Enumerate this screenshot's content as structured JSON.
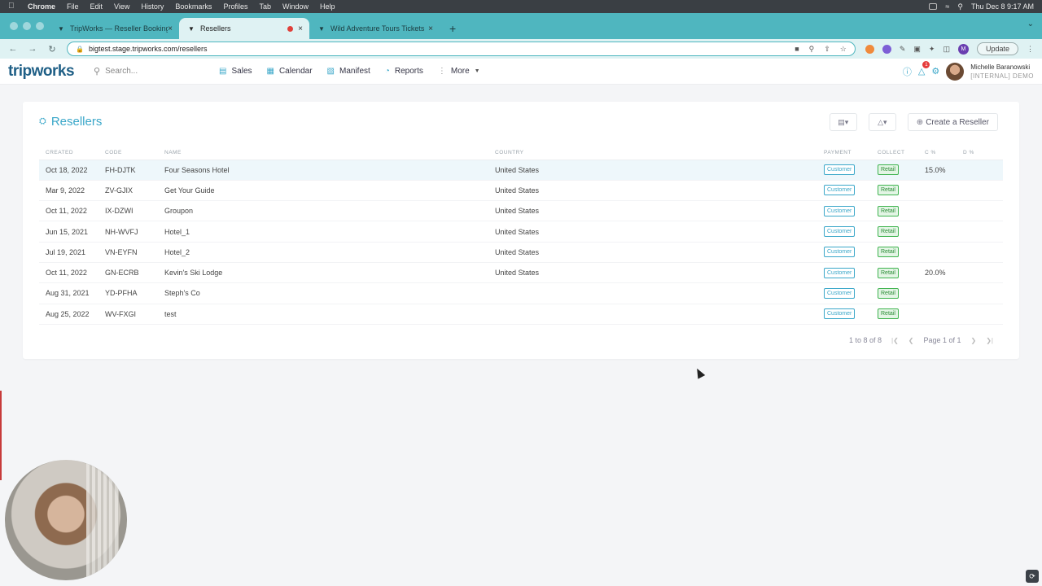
{
  "menubar": {
    "items": [
      "Chrome",
      "File",
      "Edit",
      "View",
      "History",
      "Bookmarks",
      "Profiles",
      "Tab",
      "Window",
      "Help"
    ],
    "clock": "Thu Dec 8  9:17 AM"
  },
  "browser": {
    "tabs": [
      {
        "title": "TripWorks — Reseller Booking",
        "icon": "tripworks-favicon"
      },
      {
        "title": "Resellers",
        "icon": "tripworks-favicon"
      },
      {
        "title": "Wild Adventure Tours Tickets",
        "icon": "tripworks-favicon"
      }
    ],
    "url": "bigtest.stage.tripworks.com/resellers",
    "update_label": "Update",
    "profile_initial": "M"
  },
  "app": {
    "logo": "tripworks",
    "search_placeholder": "Search...",
    "nav": [
      {
        "label": "Sales",
        "icon": "sales-icon"
      },
      {
        "label": "Calendar",
        "icon": "calendar-icon"
      },
      {
        "label": "Manifest",
        "icon": "clipboard-icon"
      },
      {
        "label": "Reports",
        "icon": "reports-icon"
      },
      {
        "label": "More",
        "icon": "more-icon"
      }
    ],
    "notification_count": "1",
    "user_name": "Michelle Baranowski",
    "user_org": "[INTERNAL] DEMO"
  },
  "page": {
    "title": "Resellers",
    "create_label": "Create a Reseller",
    "columns": [
      "CREATED",
      "CODE",
      "NAME",
      "COUNTRY",
      "PAYMENT",
      "COLLECT",
      "C %",
      "D %"
    ],
    "rows": [
      {
        "created": "Oct 18, 2022",
        "code": "FH-DJTK",
        "name": "Four Seasons Hotel",
        "country": "United States",
        "payment": "Customer",
        "collect": "Retail",
        "c": "15.0%",
        "d": ""
      },
      {
        "created": "Mar 9, 2022",
        "code": "ZV-GJIX",
        "name": "Get Your Guide",
        "country": "United States",
        "payment": "Customer",
        "collect": "Retail",
        "c": "",
        "d": ""
      },
      {
        "created": "Oct 11, 2022",
        "code": "IX-DZWI",
        "name": "Groupon",
        "country": "United States",
        "payment": "Customer",
        "collect": "Retail",
        "c": "",
        "d": ""
      },
      {
        "created": "Jun 15, 2021",
        "code": "NH-WVFJ",
        "name": "Hotel_1",
        "country": "United States",
        "payment": "Customer",
        "collect": "Retail",
        "c": "",
        "d": ""
      },
      {
        "created": "Jul 19, 2021",
        "code": "VN-EYFN",
        "name": "Hotel_2",
        "country": "United States",
        "payment": "Customer",
        "collect": "Retail",
        "c": "",
        "d": ""
      },
      {
        "created": "Oct 11, 2022",
        "code": "GN-ECRB",
        "name": "Kevin's Ski Lodge",
        "country": "United States",
        "payment": "Customer",
        "collect": "Retail",
        "c": "20.0%",
        "d": ""
      },
      {
        "created": "Aug 31, 2021",
        "code": "YD-PFHA",
        "name": "Steph's Co",
        "country": "",
        "payment": "Customer",
        "collect": "Retail",
        "c": "",
        "d": ""
      },
      {
        "created": "Aug 25, 2022",
        "code": "WV-FXGI",
        "name": "test",
        "country": "",
        "payment": "Customer",
        "collect": "Retail",
        "c": "",
        "d": ""
      }
    ],
    "pagination_summary": "1 to 8 of 8",
    "pagination_page": "Page 1 of 1"
  },
  "colors": {
    "accent": "#3aa7c9",
    "brand": "#1f5f86",
    "retail_green": "#3fb34f"
  }
}
